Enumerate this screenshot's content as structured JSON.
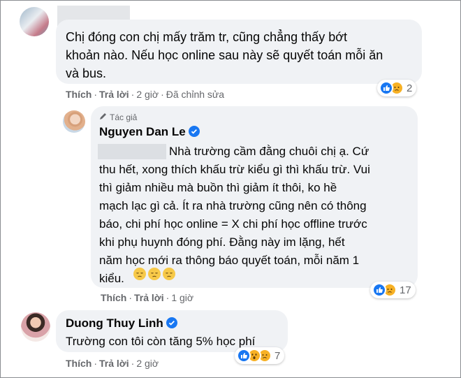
{
  "comment1": {
    "text": "Chị đóng con chị mấy trăm tr, cũng chẳng thấy bớt\nkhoản nào. Nếu học online sau này sẽ quyết toán mỗi ăn\nvà bus.",
    "like_label": "Thích",
    "reply_label": "Trả lời",
    "time": "2 giờ",
    "edited": "Đã chỉnh sửa",
    "reaction_count": "2",
    "reactions": [
      "like-icon",
      "sad-icon"
    ]
  },
  "reply1": {
    "author_badge": "Tác giả",
    "author": "Nguyen Dan Le",
    "text_first": "Nhà trường cầm đằng chuôi chị ạ. Cứ",
    "text_rest": "thu hết, xong thích khấu trừ kiểu gì thì khấu trừ. Vui\nthì giảm nhiều mà buồn thì giảm ít thôi, ko hề\nmạch lạc gì cả. Ít ra nhà trường cũng nên có thông\nbáo, chi phí học online = X chi phí học offline trước\nkhi phụ huynh đóng phí. Đằng này im lặng, hết\nnăm học mới ra thông báo quyết toán, mỗi năm 1\nkiểu.",
    "emojis": [
      "pensive-face",
      "pensive-face",
      "pensive-face"
    ],
    "like_label": "Thích",
    "reply_label": "Trả lời",
    "time": "1 giờ",
    "reaction_count": "17",
    "reactions": [
      "like-icon",
      "sad-icon"
    ]
  },
  "comment2": {
    "author": "Duong Thuy Linh",
    "text": "Trường con tôi còn tăng 5% học phí",
    "like_label": "Thích",
    "reply_label": "Trả lời",
    "time": "2 giờ",
    "reaction_count": "7",
    "reactions": [
      "like-icon",
      "wow-icon",
      "sad-icon"
    ]
  },
  "colors": {
    "bubble": "#f0f2f5",
    "meta_text": "#65676b",
    "like_blue": "#1877f2",
    "emoji_yellow": "#f7b125"
  }
}
